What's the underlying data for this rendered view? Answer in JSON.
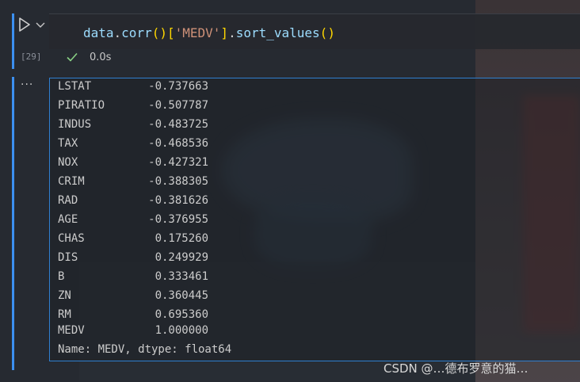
{
  "cell": {
    "execution_count": "[29]",
    "code": {
      "obj": "data",
      "dot1": ".",
      "fn1": "corr",
      "p_open": "(",
      "p_close": ")",
      "b_open": "[",
      "key": "'MEDV'",
      "b_close": "]",
      "dot2": ".",
      "fn2": "sort_values",
      "p2_open": "(",
      "p2_close": ")"
    },
    "exec_time": "0.0s"
  },
  "output": {
    "rows": [
      {
        "label": "LSTAT",
        "value": "-0.737663"
      },
      {
        "label": "PIRATIO",
        "value": "-0.507787"
      },
      {
        "label": "INDUS",
        "value": "-0.483725"
      },
      {
        "label": "TAX",
        "value": "-0.468536"
      },
      {
        "label": "NOX",
        "value": "-0.427321"
      },
      {
        "label": "CRIM",
        "value": "-0.388305"
      },
      {
        "label": "RAD",
        "value": "-0.381626"
      },
      {
        "label": "AGE",
        "value": "-0.376955"
      },
      {
        "label": "CHAS",
        "value": "0.175260"
      },
      {
        "label": "DIS",
        "value": "0.249929"
      },
      {
        "label": "B",
        "value": "0.333461"
      },
      {
        "label": "ZN",
        "value": "0.360445"
      },
      {
        "label": "RM",
        "value": "0.695360"
      },
      {
        "label": "MEDV",
        "value": "1.000000"
      }
    ],
    "footer": "Name: MEDV, dtype: float64",
    "menu": "···"
  },
  "watermark": "CSDN @‪…德布罗意的猫…",
  "colors": {
    "accent": "#3c8ff0",
    "check": "#89d185"
  },
  "icons": {
    "run": "play-icon",
    "expand": "chevron-down-icon",
    "status": "check-icon"
  }
}
